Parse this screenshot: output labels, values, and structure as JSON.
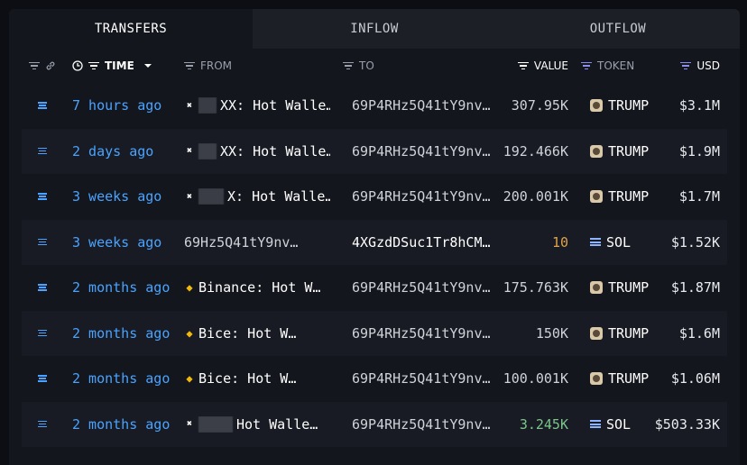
{
  "tabs": [
    {
      "label": "TRANSFERS",
      "active": true
    },
    {
      "label": "INFLOW",
      "active": false
    },
    {
      "label": "OUTFLOW",
      "active": false
    }
  ],
  "columns": {
    "time": "TIME",
    "from": "FROM",
    "to": "TO",
    "value": "VALUE",
    "token": "TOKEN",
    "usd": "USD"
  },
  "rows": [
    {
      "time": "7 hours ago",
      "from": "XX: Hot Walle…",
      "from_icon": "okx-icon",
      "to": "69P4RHz5Q41tY9nv…",
      "value": "307.95K",
      "token": "TRUMP",
      "token_icon": "trump-token-icon",
      "usd": "$3.1M"
    },
    {
      "time": "2 days ago",
      "from": "XX: Hot Walle…",
      "from_icon": "okx-icon",
      "to": "69P4RHz5Q41tY9nv…",
      "value": "192.466K",
      "token": "TRUMP",
      "token_icon": "trump-token-icon",
      "usd": "$1.9M"
    },
    {
      "time": "3 weeks ago",
      "from": "X: Hot Walle…",
      "from_icon": "okx-icon",
      "to": "69P4RHz5Q41tY9nv…",
      "value": "200.001K",
      "token": "TRUMP",
      "token_icon": "trump-token-icon",
      "usd": "$1.7M"
    },
    {
      "time": "3 weeks ago",
      "from": "69Hz5Q41tY9nv…",
      "from_icon": "",
      "to": "4XGzdDSuc1Tr8hCM…",
      "value": "10",
      "token": "SOL",
      "token_icon": "solana-token-icon",
      "usd": "$1.52K"
    },
    {
      "time": "2 months ago",
      "from": "Binance: Hot W…",
      "from_icon": "binance-icon",
      "to": "69P4RHz5Q41tY9nv…",
      "value": "175.763K",
      "token": "TRUMP",
      "token_icon": "trump-token-icon",
      "usd": "$1.87M"
    },
    {
      "time": "2 months ago",
      "from": "Bice: Hot W…",
      "from_icon": "binance-icon",
      "to": "69P4RHz5Q41tY9nv…",
      "value": "150K",
      "token": "TRUMP",
      "token_icon": "trump-token-icon",
      "usd": "$1.6M"
    },
    {
      "time": "2 months ago",
      "from": "Bice: Hot W…",
      "from_icon": "binance-icon",
      "to": "69P4RHz5Q41tY9nv…",
      "value": "100.001K",
      "token": "TRUMP",
      "token_icon": "trump-token-icon",
      "usd": "$1.06M"
    },
    {
      "time": "2 months ago",
      "from": "Hot Walle…",
      "from_icon": "okx-icon",
      "to": "69P4RHz5Q41tY9nv…",
      "value": "3.245K",
      "token": "SOL",
      "token_icon": "solana-token-icon",
      "usd": "$503.33K"
    }
  ],
  "colors": {
    "link_blue": "#4aa3ff",
    "value_orange": "#e0a24a",
    "value_green": "#7cc58a",
    "filter_purple": "#8d8cf0",
    "binance_yellow": "#f0b90b"
  }
}
